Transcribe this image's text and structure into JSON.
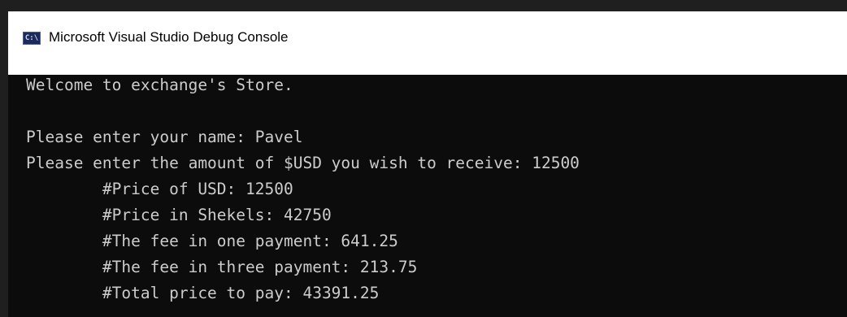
{
  "window": {
    "title": "Microsoft Visual Studio Debug Console",
    "icon": "console-app-icon",
    "icon_glyph": "C:\\"
  },
  "console": {
    "lines": [
      "Welcome to exchange's Store.",
      "",
      "Please enter your name: Pavel",
      "Please enter the amount of $USD you wish to receive: 12500",
      "        #Price of USD: 12500",
      "        #Price in Shekels: 42750",
      "        #The fee in one payment: 641.25",
      "        #The fee in three payment: 213.75",
      "        #Total price to pay: 43391.25"
    ]
  },
  "colors": {
    "console_background": "#0c0c0c",
    "console_text": "#cccccc",
    "titlebar_background": "#ffffff"
  }
}
